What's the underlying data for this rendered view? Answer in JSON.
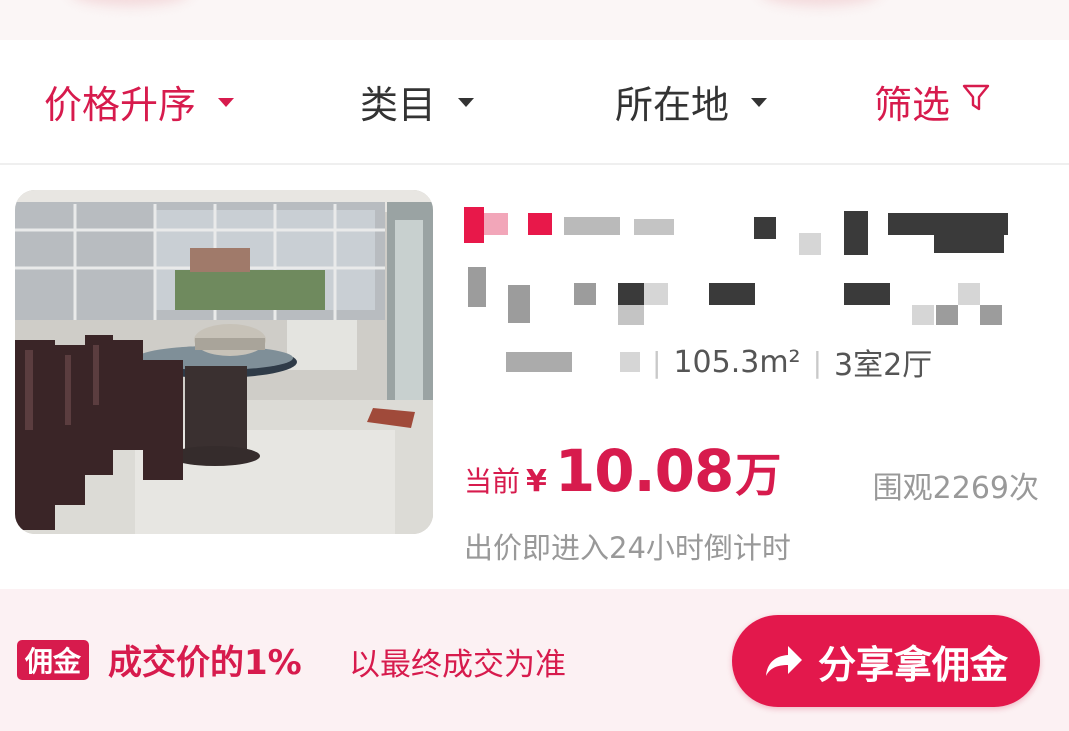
{
  "filters": {
    "price_sort": "价格升序",
    "category": "类目",
    "location": "所在地",
    "filter": "筛选",
    "filter_icon": "⛉"
  },
  "listing": {
    "area": "105.3m²",
    "layout": "3室2厅",
    "price_prefix": "当前",
    "currency": "¥",
    "price_value": "10.08",
    "price_unit": "万",
    "views": "围观2269次",
    "countdown_note": "出价即进入24小时倒计时"
  },
  "commission": {
    "tag": "佣金",
    "main": "成交价的1%",
    "note": "以最终成交为准",
    "share_button": "分享拿佣金"
  },
  "colors": {
    "accent": "#d71b4d",
    "button": "#e3184c",
    "commission_bg": "#fcf1f3"
  }
}
